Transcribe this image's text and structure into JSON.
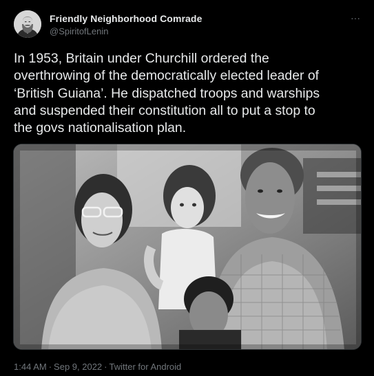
{
  "tweet": {
    "author": {
      "display_name": "Friendly Neighborhood Comrade",
      "handle": "@SpiritofLenin"
    },
    "more_icon": "more-horizontal-icon",
    "more_glyph": "···",
    "text": "In 1953, Britain under Churchill ordered the\noverthrowing of the democratically elected leader of\n‘British Guiana’. He dispatched troops and warships\nand suspended their constitution all to put a stop to\nthe govs nationalisation plan.",
    "meta": {
      "time": "1:44 AM",
      "separator": "·",
      "date": "Sep 9, 2022",
      "source": "Twitter for Android"
    }
  },
  "colors": {
    "background": "#000000",
    "primary_text": "#e7e9ea",
    "secondary_text": "#71767b",
    "border": "#2f3336"
  }
}
